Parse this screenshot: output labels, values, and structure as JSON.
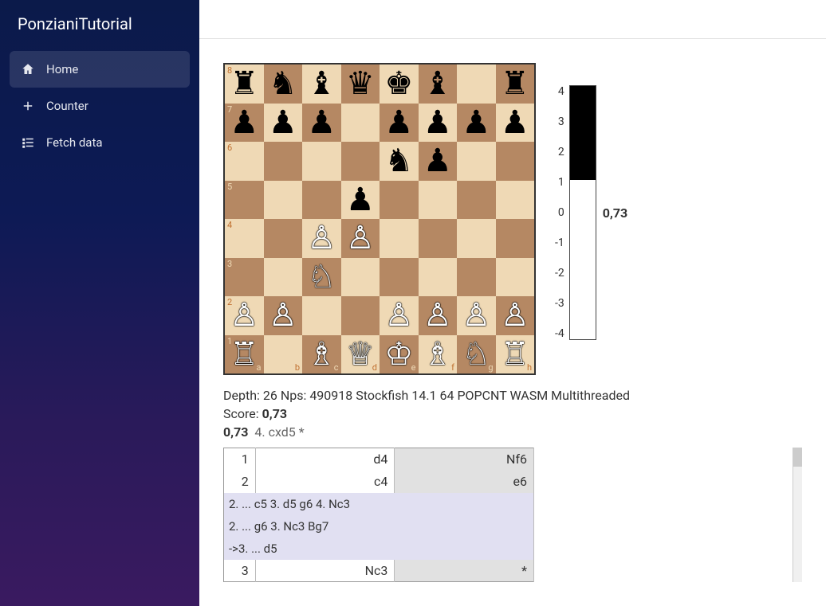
{
  "brand": "PonzianiTutorial",
  "sidebar": {
    "items": [
      {
        "label": "Home",
        "icon": "home",
        "active": true
      },
      {
        "label": "Counter",
        "icon": "plus",
        "active": false
      },
      {
        "label": "Fetch data",
        "icon": "list",
        "active": false
      }
    ]
  },
  "board": {
    "fen_rows": [
      "rnbqkb.r",
      "ppp.pppp",
      "....np..",
      "...p....",
      "..PP....",
      "..N.....",
      "PP..PPPP",
      "R.BQKBNR"
    ],
    "files": [
      "a",
      "b",
      "c",
      "d",
      "e",
      "f",
      "g",
      "h"
    ],
    "ranks": [
      "8",
      "7",
      "6",
      "5",
      "4",
      "3",
      "2",
      "1"
    ]
  },
  "eval": {
    "axis": [
      "4",
      "3",
      "2",
      "1",
      "0",
      "-1",
      "-2",
      "-3",
      "-4"
    ],
    "current_label": "0,73",
    "white_fraction": 0.63
  },
  "engine": {
    "info_line": "Depth: 26 Nps: 490918 Stockfish 14.1 64 POPCNT WASM Multithreaded",
    "score_prefix": "Score: ",
    "score_value": "0,73",
    "pv_score": "0,73",
    "pv_moves": "4. cxd5 *"
  },
  "moves": {
    "rows": [
      {
        "n": "1",
        "w": "d4",
        "b": "Nf6"
      },
      {
        "n": "2",
        "w": "c4",
        "b": "e6"
      }
    ],
    "variations": [
      "2. ... c5 3. d5 g6 4. Nc3",
      "2. ... g6 3. Nc3 Bg7",
      "->3. ... d5"
    ],
    "tail": {
      "n": "3",
      "w": "Nc3",
      "b": "*"
    }
  }
}
